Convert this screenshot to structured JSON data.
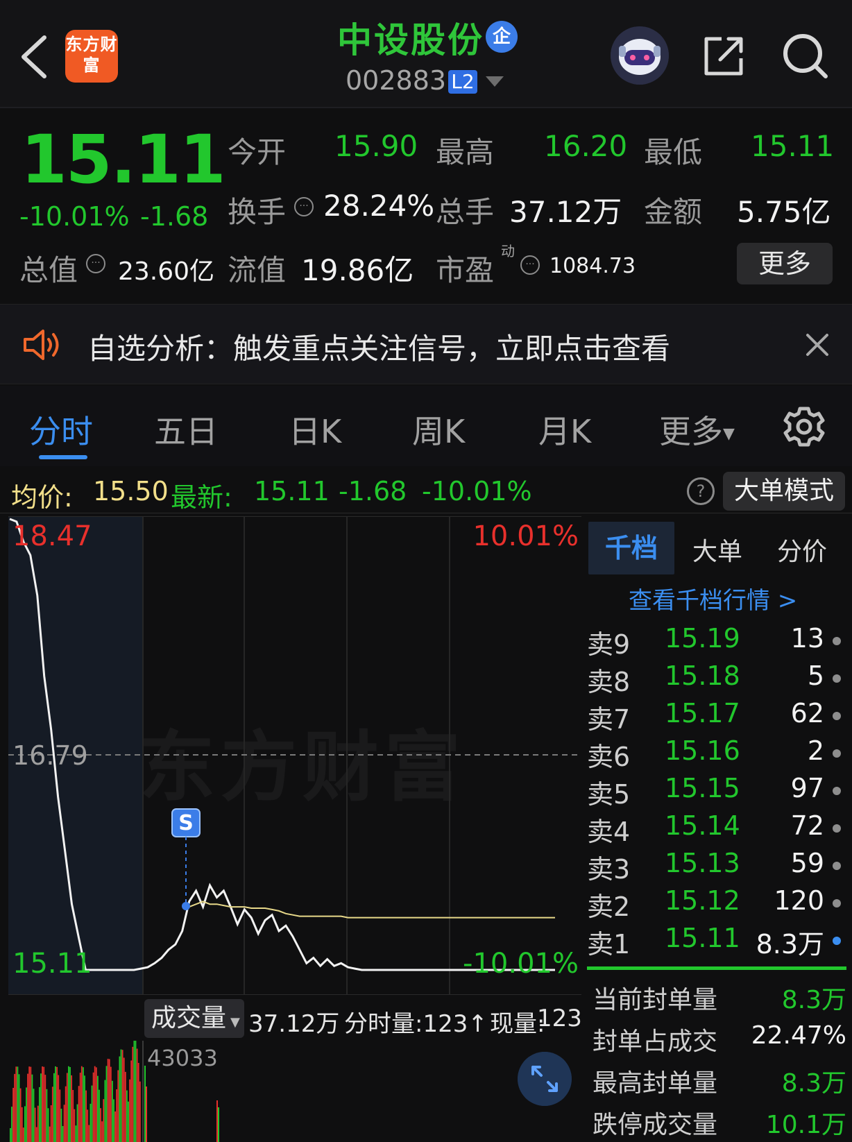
{
  "header": {
    "logo_text": "东方财富",
    "stock_name": "中设股份",
    "enterprise_badge": "企",
    "stock_code": "002883",
    "level_badge": "L2",
    "icons": [
      "back-arrow-icon",
      "robot-avatar-icon",
      "share-icon",
      "search-icon"
    ]
  },
  "quote": {
    "price": "15.11",
    "change_pct": "-10.01%",
    "change_abs": "-1.68",
    "open_label": "今开",
    "open_value": "15.90",
    "high_label": "最高",
    "high_value": "16.20",
    "low_label": "最低",
    "low_value": "15.11",
    "turnover_label": "换手",
    "turnover_value": "28.24%",
    "volume_label": "总手",
    "volume_value": "37.12万",
    "amount_label": "金额",
    "amount_value": "5.75亿",
    "mcap_label": "总值",
    "mcap_value": "23.60亿",
    "float_label": "流值",
    "float_value": "19.86亿",
    "pe_label": "市盈",
    "pe_sup": "动",
    "pe_value": "1084.73",
    "more_label": "更多"
  },
  "banner": {
    "text": "自选分析：触发重点关注信号，立即点击查看"
  },
  "tabs": [
    {
      "label": "分时",
      "active": true
    },
    {
      "label": "五日",
      "active": false
    },
    {
      "label": "日K",
      "active": false
    },
    {
      "label": "周K",
      "active": false
    },
    {
      "label": "月K",
      "active": false
    },
    {
      "label": "更多",
      "active": false
    }
  ],
  "infoline": {
    "avg_label": "均价:",
    "avg_value": "15.50",
    "latest_label": "最新:",
    "latest_value": "15.11",
    "latest_change": "-1.68",
    "latest_pct": "-10.01%",
    "help": "?",
    "big_order_button": "大单模式"
  },
  "chart_data": {
    "type": "line",
    "title": "",
    "y_max_label": "18.47",
    "y_mid_label": "16.79",
    "y_min_label": "15.11",
    "pct_max_label": "10.01%",
    "pct_min_label": "-10.01%",
    "ylim": [
      15.11,
      18.47
    ],
    "prev_close": 16.79,
    "watermark": "东方财富",
    "marker_label": "S",
    "series": [
      {
        "values": [
          18.47,
          18.45,
          18.3,
          18.2,
          17.9,
          17.3,
          16.9,
          16.4,
          16.0,
          15.6,
          15.35,
          15.11,
          15.11,
          15.11,
          15.11,
          15.11,
          15.11,
          15.11,
          15.11,
          15.12,
          15.13,
          15.16,
          15.2,
          15.26,
          15.3,
          15.4,
          15.62,
          15.7,
          15.58,
          15.74,
          15.65,
          15.7,
          15.58,
          15.45,
          15.56,
          15.5,
          15.38,
          15.48,
          15.52,
          15.4,
          15.44,
          15.36,
          15.26,
          15.16,
          15.2,
          15.14,
          15.19,
          15.14,
          15.16,
          15.13,
          15.12,
          15.11,
          15.11,
          15.11,
          15.11,
          15.11,
          15.11,
          15.11,
          15.11,
          15.11,
          15.11,
          15.11,
          15.11,
          15.11,
          15.11,
          15.11,
          15.11,
          15.11,
          15.11,
          15.11,
          15.11,
          15.11,
          15.11,
          15.11,
          15.11,
          15.11,
          15.11,
          15.11,
          15.11,
          15.11
        ]
      },
      {
        "values": [
          null,
          null,
          null,
          null,
          null,
          null,
          null,
          null,
          null,
          null,
          null,
          null,
          null,
          null,
          null,
          null,
          null,
          null,
          null,
          null,
          null,
          null,
          null,
          null,
          null,
          null,
          15.58,
          15.6,
          15.62,
          15.6,
          15.6,
          15.59,
          15.58,
          15.58,
          15.58,
          15.57,
          15.57,
          15.57,
          15.56,
          15.55,
          15.53,
          15.52,
          15.51,
          15.51,
          15.51,
          15.51,
          15.51,
          15.51,
          15.51,
          15.5,
          15.5,
          15.5,
          15.5,
          15.5,
          15.5,
          15.5,
          15.5,
          15.5,
          15.5,
          15.5,
          15.5,
          15.5,
          15.5,
          15.5,
          15.5,
          15.5,
          15.5,
          15.5,
          15.5,
          15.5,
          15.5,
          15.5,
          15.5,
          15.5,
          15.5,
          15.5,
          15.5,
          15.5,
          15.5,
          15.5
        ]
      }
    ]
  },
  "volume_bar": {
    "dropdown_label": "成交量",
    "total": "37.12万",
    "tick_volume": "分时量:123↑",
    "current_label": "现量:",
    "current_value": "123",
    "max_label": "43033"
  },
  "orderbook": {
    "tabs": [
      "千档",
      "大单",
      "分价"
    ],
    "link_text": "查看千档行情 >",
    "rows": [
      {
        "level": "卖9",
        "price": "15.19",
        "qty": "13"
      },
      {
        "level": "卖8",
        "price": "15.18",
        "qty": "5"
      },
      {
        "level": "卖7",
        "price": "15.17",
        "qty": "62"
      },
      {
        "level": "卖6",
        "price": "15.16",
        "qty": "2"
      },
      {
        "level": "卖5",
        "price": "15.15",
        "qty": "97"
      },
      {
        "level": "卖4",
        "price": "15.14",
        "qty": "72"
      },
      {
        "level": "卖3",
        "price": "15.13",
        "qty": "59"
      },
      {
        "level": "卖2",
        "price": "15.12",
        "qty": "120"
      },
      {
        "level": "卖1",
        "price": "15.11",
        "qty": "8.3万"
      }
    ],
    "stats": [
      {
        "label": "当前封单量",
        "value": "8.3万"
      },
      {
        "label": "封单占成交",
        "value": "22.47%"
      },
      {
        "label": "最高封单量",
        "value": "8.3万"
      },
      {
        "label": "跌停成交量",
        "value": "10.1万"
      }
    ]
  }
}
